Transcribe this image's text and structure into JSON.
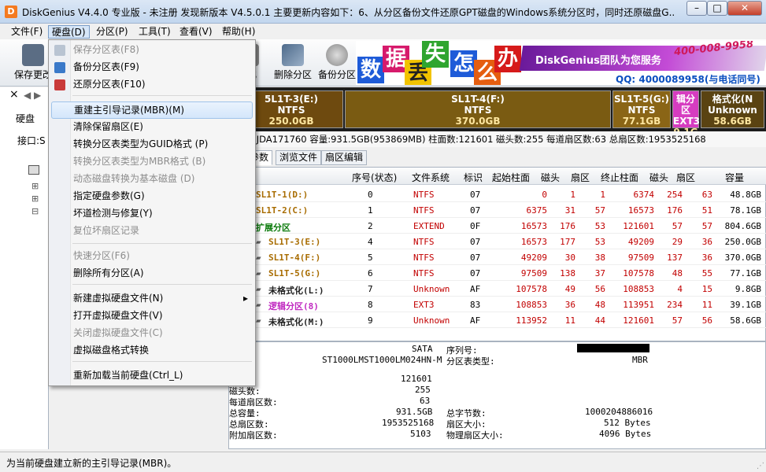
{
  "window": {
    "title": "DiskGenius V4.4.0 专业版 - 未注册   发现新版本 V4.5.0.1 主要更新内容如下：6、从分区备份文件还原GPT磁盘的Windows系统分区时，同时还原磁盘G...",
    "app_icon": "D"
  },
  "menubar": [
    "文件(F)",
    "硬盘(D)",
    "分区(P)",
    "工具(T)",
    "查看(V)",
    "帮助(H)"
  ],
  "toolbar": {
    "save_label": "保存更改",
    "hidden_label": "化",
    "delete_label": "删除分区",
    "backup_label": "备份分区"
  },
  "banner": {
    "chars": [
      "数",
      "据",
      "丢",
      "失",
      "怎",
      "么",
      "办"
    ],
    "text": "DiskGenius团队为您服务",
    "phone": "400-008-9958",
    "qq": "QQ: 4000089958(与电话同号)"
  },
  "left": {
    "disk_label": "硬盘",
    "iface_label": "接口:S"
  },
  "partitions": [
    {
      "name": "5L1T-3(E:)",
      "fs": "NTFS",
      "size": "250.0GB",
      "bg": "#6e4a0f"
    },
    {
      "name": "SL1T-4(F:)",
      "fs": "NTFS",
      "size": "370.0GB",
      "bg": "#7a5b12"
    },
    {
      "name": "SL1T-5(G:)",
      "fs": "NTFS",
      "size": "77.1GB",
      "bg": "#8a6516"
    },
    {
      "name": "辑分区",
      "fs": "EXT3",
      "size": "9.1G",
      "bg": "#d63cc0"
    },
    {
      "name": "格式化(N",
      "fs": "Unknown",
      "size": "58.6GB",
      "bg": "#5a4312"
    }
  ],
  "infoline": "UR9JDA171760   容量:931.5GB(953869MB)   柱面数:121601   磁头数:255   每道扇区数:63   总扇区数:1953525168",
  "tabs": [
    "参数",
    "浏览文件",
    "扇区编辑"
  ],
  "table": {
    "headers": [
      "序号(状态)",
      "文件系统",
      "标识",
      "起始柱面",
      "磁头",
      "扇区",
      "终止柱面",
      "磁头",
      "扇区",
      "容量"
    ],
    "rows": [
      {
        "name": "SL1T-1(D:)",
        "idx": "0",
        "fs": "NTFS",
        "id": "07",
        "sc": "0",
        "sh": "1",
        "ss": "1",
        "ec": "6374",
        "eh": "254",
        "es": "63",
        "cap": "48.8GB",
        "color": "#a86c00"
      },
      {
        "name": "SL1T-2(C:)",
        "idx": "1",
        "fs": "NTFS",
        "id": "07",
        "sc": "6375",
        "sh": "31",
        "ss": "57",
        "ec": "16573",
        "eh": "176",
        "es": "51",
        "cap": "78.1GB",
        "color": "#a86c00"
      },
      {
        "name": "扩展分区",
        "idx": "2",
        "fs": "EXTEND",
        "id": "0F",
        "sc": "16573",
        "sh": "176",
        "ss": "53",
        "ec": "121601",
        "eh": "57",
        "es": "57",
        "cap": "804.6GB",
        "color": "#0a7a0a"
      },
      {
        "name": "SL1T-3(E:)",
        "idx": "4",
        "fs": "NTFS",
        "id": "07",
        "sc": "16573",
        "sh": "177",
        "ss": "53",
        "ec": "49209",
        "eh": "29",
        "es": "36",
        "cap": "250.0GB",
        "color": "#a86c00"
      },
      {
        "name": "SL1T-4(F:)",
        "idx": "5",
        "fs": "NTFS",
        "id": "07",
        "sc": "49209",
        "sh": "30",
        "ss": "38",
        "ec": "97509",
        "eh": "137",
        "es": "36",
        "cap": "370.0GB",
        "color": "#a86c00"
      },
      {
        "name": "SL1T-5(G:)",
        "idx": "6",
        "fs": "NTFS",
        "id": "07",
        "sc": "97509",
        "sh": "138",
        "ss": "37",
        "ec": "107578",
        "eh": "48",
        "es": "55",
        "cap": "77.1GB",
        "color": "#a86c00"
      },
      {
        "name": "未格式化(L:)",
        "idx": "7",
        "fs": "Unknown",
        "id": "AF",
        "sc": "107578",
        "sh": "49",
        "ss": "56",
        "ec": "108853",
        "eh": "4",
        "es": "15",
        "cap": "9.8GB",
        "color": "#222222"
      },
      {
        "name": "逻辑分区(8)",
        "idx": "8",
        "fs": "EXT3",
        "id": "83",
        "sc": "108853",
        "sh": "36",
        "ss": "48",
        "ec": "113951",
        "eh": "234",
        "es": "11",
        "cap": "39.1GB",
        "color": "#c028c0"
      },
      {
        "name": "未格式化(M:)",
        "idx": "9",
        "fs": "Unknown",
        "id": "AF",
        "sc": "113952",
        "sh": "11",
        "ss": "44",
        "ec": "121601",
        "eh": "57",
        "es": "56",
        "cap": "58.6GB",
        "color": "#222222"
      }
    ]
  },
  "details": {
    "type_label": "型:",
    "type_value": "SATA",
    "model_value": "ST1000LMST1000LM024HN-M",
    "serial_label": "序列号:",
    "pt_label": "分区表类型:",
    "pt_value": "MBR",
    "cyl_label": "数:",
    "cyl_value": "121601",
    "heads_label": "磁头数:",
    "heads_value": "255",
    "spt_label": "每道扇区数:",
    "spt_value": "63",
    "cap_label": "总容量:",
    "cap_value": "931.5GB",
    "ts_label": "总扇区数:",
    "ts_value": "1953525168",
    "extra_label": "附加扇区数:",
    "extra_value": "5103",
    "bytes_label": "总字节数:",
    "bytes_value": "1000204886016",
    "sec_label": "扇区大小:",
    "sec_value": "512 Bytes",
    "psec_label": "物理扇区大小:",
    "psec_value": "4096 Bytes"
  },
  "status": "为当前硬盘建立新的主引导记录(MBR)。",
  "dropdown": {
    "items": [
      {
        "label": "保存分区表(F8)",
        "disabled": true,
        "icon": "save-table-icon"
      },
      {
        "label": "备份分区表(F9)",
        "disabled": false,
        "icon": "backup-table-icon"
      },
      {
        "label": "还原分区表(F10)",
        "disabled": false,
        "icon": "restore-table-icon"
      },
      {
        "label": "重建主引导记录(MBR)(M)",
        "disabled": false,
        "highlight": true
      },
      {
        "label": "清除保留扇区(E)",
        "disabled": false
      },
      {
        "label": "转换分区表类型为GUID格式 (P)",
        "disabled": false
      },
      {
        "label": "转换分区表类型为MBR格式 (B)",
        "disabled": true
      },
      {
        "label": "动态磁盘转换为基本磁盘 (D)",
        "disabled": true
      },
      {
        "label": "指定硬盘参数(G)",
        "disabled": false
      },
      {
        "label": "坏道检测与修复(Y)",
        "disabled": false
      },
      {
        "label": "复位坏扇区记录",
        "disabled": true
      },
      {
        "label": "快速分区(F6)",
        "disabled": true
      },
      {
        "label": "删除所有分区(A)",
        "disabled": false
      },
      {
        "label": "新建虚拟硬盘文件(N)",
        "disabled": false,
        "submenu": true
      },
      {
        "label": "打开虚拟硬盘文件(V)",
        "disabled": false
      },
      {
        "label": "关闭虚拟硬盘文件(C)",
        "disabled": true
      },
      {
        "label": "虚拟磁盘格式转换",
        "disabled": false
      },
      {
        "label": "重新加载当前硬盘(Ctrl_L)",
        "disabled": false
      }
    ]
  },
  "colors": {
    "accent": "#3a79c9",
    "disabled": "#8d8d8d",
    "value_red": "#c20000"
  }
}
